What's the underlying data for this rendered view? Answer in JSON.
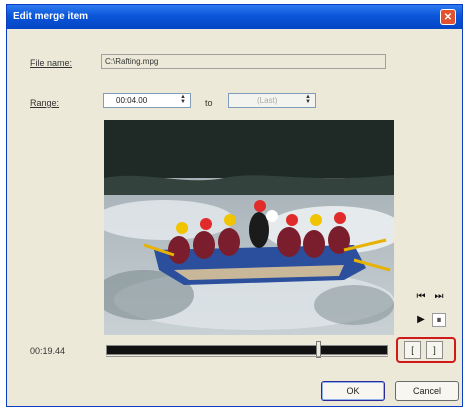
{
  "window": {
    "title": "Edit merge item",
    "close_glyph": "✕"
  },
  "file": {
    "label": "File name:",
    "value": "C:\\Rafting.mpg"
  },
  "range": {
    "label": "Range:",
    "start": "00:04.00",
    "to_label": "to",
    "end": "(Last)"
  },
  "controls": {
    "prev_icon": "⏮",
    "next_icon": "⏭",
    "play_icon": "▶",
    "pause_icon": "⏸"
  },
  "position": {
    "time": "00:19.44"
  },
  "mark": {
    "in_label": "[",
    "out_label": "]"
  },
  "buttons": {
    "ok": "OK",
    "cancel": "Cancel"
  },
  "colors": {
    "titlebar": "#0a55d8",
    "highlight": "#d01919",
    "dialog_bg": "#ece9d8"
  }
}
